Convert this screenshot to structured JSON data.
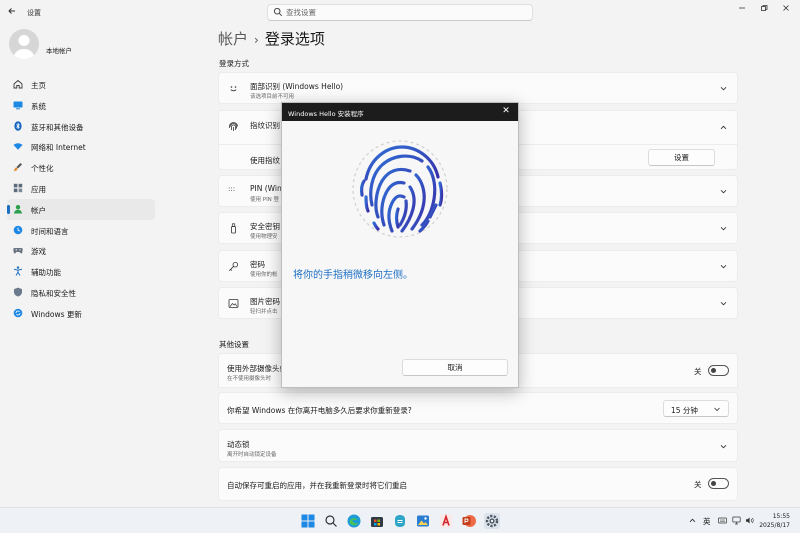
{
  "window": {
    "title": "设置"
  },
  "search": {
    "placeholder": "查找设置"
  },
  "user": {
    "name": "本地帐户"
  },
  "nav": {
    "items": [
      {
        "label": "主页",
        "icon": "home-icon",
        "color": "#3b3b3b"
      },
      {
        "label": "系统",
        "icon": "monitor-icon",
        "color": "#1e88e5"
      },
      {
        "label": "蓝牙和其他设备",
        "icon": "bluetooth-icon",
        "color": "#1565c0"
      },
      {
        "label": "网络和 Internet",
        "icon": "wifi-icon",
        "color": "#1e88e5"
      },
      {
        "label": "个性化",
        "icon": "brush-icon",
        "color": "#e08a2b"
      },
      {
        "label": "应用",
        "icon": "apps-icon",
        "color": "#556"
      },
      {
        "label": "帐户",
        "icon": "person-icon",
        "color": "#2aa04a"
      },
      {
        "label": "时间和语言",
        "icon": "globe-clock-icon",
        "color": "#1e88e5"
      },
      {
        "label": "游戏",
        "icon": "gamepad-icon",
        "color": "#667"
      },
      {
        "label": "辅助功能",
        "icon": "accessibility-icon",
        "color": "#1e6fc4"
      },
      {
        "label": "隐私和安全性",
        "icon": "shield-icon",
        "color": "#6b7a8c"
      },
      {
        "label": "Windows 更新",
        "icon": "update-icon",
        "color": "#1e88e5"
      }
    ],
    "active_index": 6
  },
  "breadcrumb": {
    "parent": "帐户",
    "separator": "›",
    "current": "登录选项"
  },
  "sections": {
    "signin": "登录方式",
    "other": "其他设置"
  },
  "signin_options": {
    "face": {
      "title": "面部识别 (Windows Hello)",
      "subtitle": "该选项目前不可用"
    },
    "fingerprint": {
      "title": "指纹识别",
      "sub_row_label": "使用指纹",
      "setup_label": "设置"
    },
    "pin": {
      "title": "PIN (Windo",
      "subtitle": "使用 PIN 登"
    },
    "security_key": {
      "title": "安全密钥",
      "subtitle": "使用物理安"
    },
    "password": {
      "title": "密码",
      "subtitle": "使用你的帐"
    },
    "picture_password": {
      "title": "图片密码",
      "subtitle": "轻扫并点击"
    }
  },
  "other_settings": {
    "external_camera": {
      "title": "使用外部摄像头或",
      "subtitle": "在不使用摄像头时",
      "toggle_label": "关"
    },
    "resign": {
      "title": "你希望 Windows 在你离开电脑多久后要求你重新登录?",
      "value": "15 分钟"
    },
    "dynamic_lock": {
      "title": "动态锁",
      "subtitle": "离开时自动锁定设备"
    },
    "restart_apps": {
      "title": "自动保存可重启的应用，并在我重新登录时将它们重启",
      "toggle_label": "关"
    }
  },
  "dialog": {
    "title": "Windows Hello 安装程序",
    "close_glyph": "✕",
    "message": "将你的手指稍微移向左侧。",
    "cancel_label": "取消",
    "accent": "#1e6fc4"
  },
  "taskbar": {
    "apps": [
      "start-icon",
      "search-icon",
      "edge-icon",
      "store-icon",
      "copilot-icon",
      "photos-icon",
      "acrobat-icon",
      "powerpoint-icon",
      "settings-icon"
    ],
    "tray": {
      "ime": "英"
    },
    "clock": {
      "time": "15:55",
      "date": "2025/8/17"
    }
  }
}
